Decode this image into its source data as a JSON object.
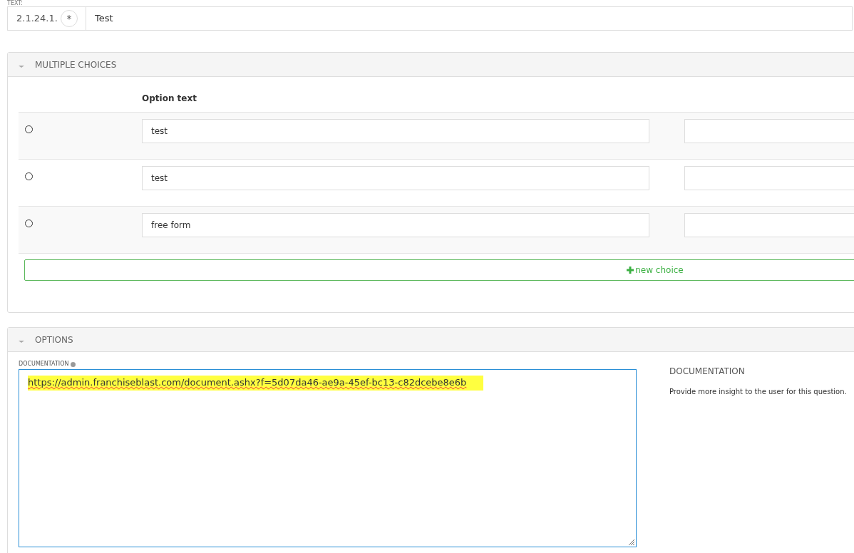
{
  "text_field": {
    "label": "TEXT:",
    "number": "2.1.24.1.",
    "required_marker": "*",
    "value": "Test"
  },
  "multiple_choices": {
    "title": "MULTIPLE CHOICES",
    "expanded": true,
    "column_header": "Option text",
    "choices": [
      {
        "text": "test",
        "selected": false
      },
      {
        "text": "test",
        "selected": false
      },
      {
        "text": "free form",
        "selected": false
      }
    ],
    "add_button": "new choice"
  },
  "options": {
    "title": "OPTIONS",
    "expanded": true,
    "documentation_label": "DOCUMENTATION",
    "documentation_value": "https://admin.franchiseblast.com/document.ashx?f=5d07da46-ae9a-45ef-bc13-c82dcebe8e6b",
    "documentation_highlighted": true,
    "help_title": "DOCUMENTATION",
    "help_text": "Provide more insight to the user for this question."
  }
}
